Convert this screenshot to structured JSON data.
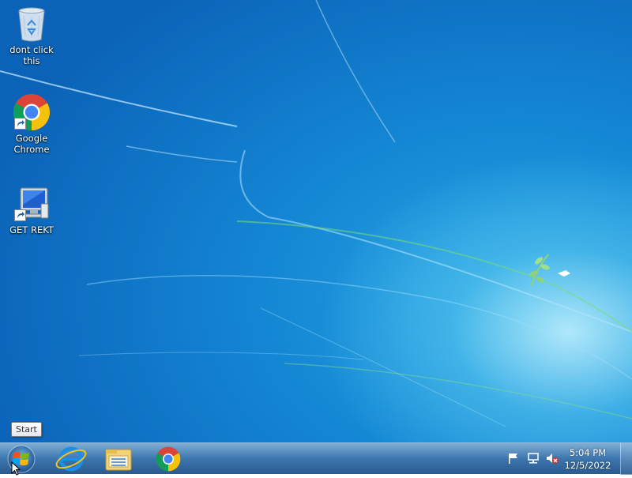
{
  "desktop": {
    "icons": [
      {
        "label": "dont click this",
        "icon": "recycle-bin-icon"
      },
      {
        "label": "Google\nChrome",
        "icon": "chrome-icon"
      },
      {
        "label": "GET REKT",
        "icon": "computer-icon"
      }
    ]
  },
  "taskbar": {
    "start_tooltip": "Start",
    "pinned": [
      {
        "name": "Internet Explorer",
        "icon": "internet-explorer-icon"
      },
      {
        "name": "Windows Explorer",
        "icon": "file-explorer-icon"
      },
      {
        "name": "Google Chrome",
        "icon": "chrome-icon"
      }
    ],
    "tray": {
      "icons": [
        "action-center-flag-icon",
        "network-icon",
        "volume-muted-icon"
      ],
      "time": "5:04 PM",
      "date": "12/5/2022"
    }
  },
  "colors": {
    "desktop_blue": "#1487d4",
    "taskbar": "#326eaa"
  }
}
